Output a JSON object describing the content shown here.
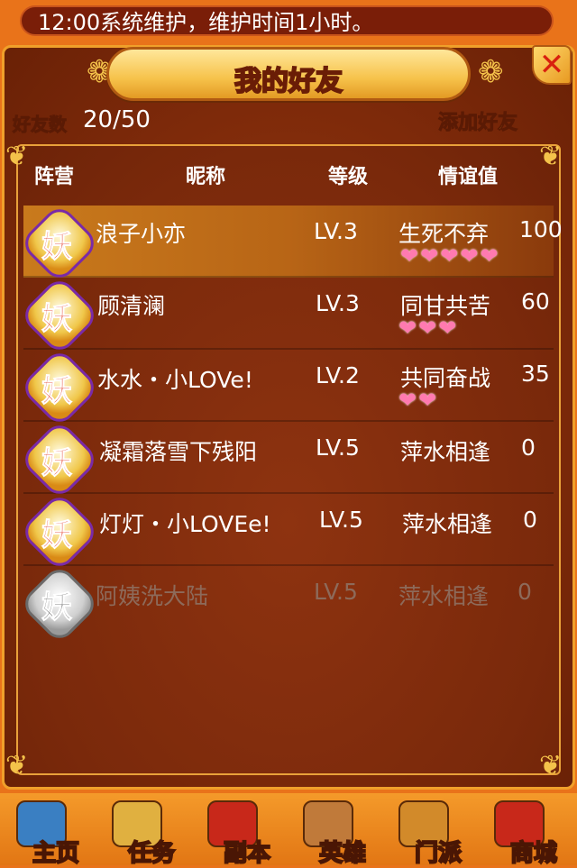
{
  "notice": "12:00系统维护，维护时间1小时。",
  "panel": {
    "title_a": "我的",
    "title_b": "好友",
    "friend_count_label": "好友数",
    "friend_count_value": "20/50",
    "add_friend_label": "添加好友"
  },
  "headers": {
    "faction": "阵营",
    "nickname": "昵称",
    "level": "等级",
    "affinity": "情谊值"
  },
  "friends": [
    {
      "faction": "妖",
      "name": "浪子小亦",
      "level": "LV.3",
      "relation": "生死不弃",
      "affinity": "100",
      "hearts": "❤❤❤❤❤",
      "hearts_count": 5
    },
    {
      "faction": "妖",
      "name": "顾清澜",
      "level": "LV.3",
      "relation": "同甘共苦",
      "affinity": "60",
      "hearts": "❤❤❤",
      "hearts_count": 3
    },
    {
      "faction": "妖",
      "name": "水水・小LOVe!",
      "level": "LV.2",
      "relation": "共同奋战",
      "affinity": "35",
      "hearts": "❤❤",
      "hearts_count": 2
    },
    {
      "faction": "妖",
      "name": "凝霜落雪下残阳",
      "level": "LV.5",
      "relation": "萍水相逢",
      "affinity": "0",
      "hearts": "",
      "hearts_count": 0
    },
    {
      "faction": "妖",
      "name": "灯灯・小LOVEe!",
      "level": "LV.5",
      "relation": "萍水相逢",
      "affinity": "0",
      "hearts": "",
      "hearts_count": 0
    },
    {
      "faction": "妖",
      "name": "阿姨洗大陆",
      "level": "LV.5",
      "relation": "萍水相逢",
      "affinity": "0",
      "hearts": "",
      "hearts_count": 0,
      "offline": true
    }
  ],
  "nav": [
    {
      "label": "主页",
      "icon": "home-icon",
      "color": "#3a7fc2"
    },
    {
      "label": "任务",
      "icon": "scroll-icon",
      "color": "#e0b040"
    },
    {
      "label": "副本",
      "icon": "flag-icon",
      "color": "#c8281a"
    },
    {
      "label": "英雄",
      "icon": "hero-icon",
      "color": "#c07a3a"
    },
    {
      "label": "门派",
      "icon": "shield-icon",
      "color": "#d28a2a"
    },
    {
      "label": "商城",
      "icon": "chest-icon",
      "color": "#c8281a"
    }
  ],
  "colors": {
    "accent": "#ffe23a",
    "heart": "#ff7ab0",
    "panel_border": "#f0a02a"
  }
}
